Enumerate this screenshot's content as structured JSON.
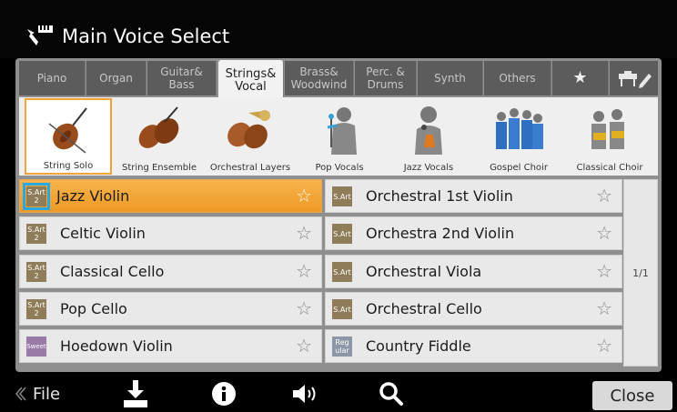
{
  "title": "Main Voice Select",
  "tabs": [
    {
      "label": "Piano"
    },
    {
      "label": "Organ"
    },
    {
      "label": "Guitar& Bass"
    },
    {
      "label": "Strings& Vocal"
    },
    {
      "label": "Brass& Woodwind"
    },
    {
      "label": "Perc. & Drums"
    },
    {
      "label": "Synth"
    },
    {
      "label": "Others"
    },
    {
      "label": "★"
    },
    {
      "icon": "user-voice-icon"
    }
  ],
  "active_tab": "Strings& Vocal",
  "subcategories": [
    {
      "label": "String Solo",
      "icon": "violin-icon",
      "selected": true
    },
    {
      "label": "String Ensemble",
      "icon": "string-ensemble-icon"
    },
    {
      "label": "Orchestral Layers",
      "icon": "orchestral-layers-icon"
    },
    {
      "label": "Pop Vocals",
      "icon": "pop-vocals-icon"
    },
    {
      "label": "Jazz Vocals",
      "icon": "jazz-vocals-icon"
    },
    {
      "label": "Gospel Choir",
      "icon": "gospel-choir-icon"
    },
    {
      "label": "Classical Choir",
      "icon": "classical-choir-icon"
    }
  ],
  "voices_left": [
    {
      "badge": "S.Art 2",
      "name": "Jazz Violin",
      "selected": true
    },
    {
      "badge": "S.Art 2",
      "name": "Celtic Violin"
    },
    {
      "badge": "S.Art 2",
      "name": "Classical Cello"
    },
    {
      "badge": "S.Art 2",
      "name": "Pop Cello"
    },
    {
      "badge": "Sweet",
      "name": "Hoedown Violin"
    }
  ],
  "voices_right": [
    {
      "badge": "S.Art",
      "name": "Orchestral 1st Violin"
    },
    {
      "badge": "S.Art",
      "name": "Orchestra 2nd Violin"
    },
    {
      "badge": "S.Art",
      "name": "Orchestral Viola"
    },
    {
      "badge": "S.Art",
      "name": "Orchestral Cello"
    },
    {
      "badge": "Reg ular",
      "name": "Country Fiddle"
    }
  ],
  "page_indicator": "1/1",
  "bottom": {
    "file_label": "File",
    "close_label": "Close"
  },
  "colors": {
    "selected_voice": "#f0a030",
    "focus_outline": "#2aa6e0",
    "badge_sart": "#8e7d58",
    "badge_sweet": "#9a7aa6",
    "badge_regular": "#8b97a6"
  }
}
